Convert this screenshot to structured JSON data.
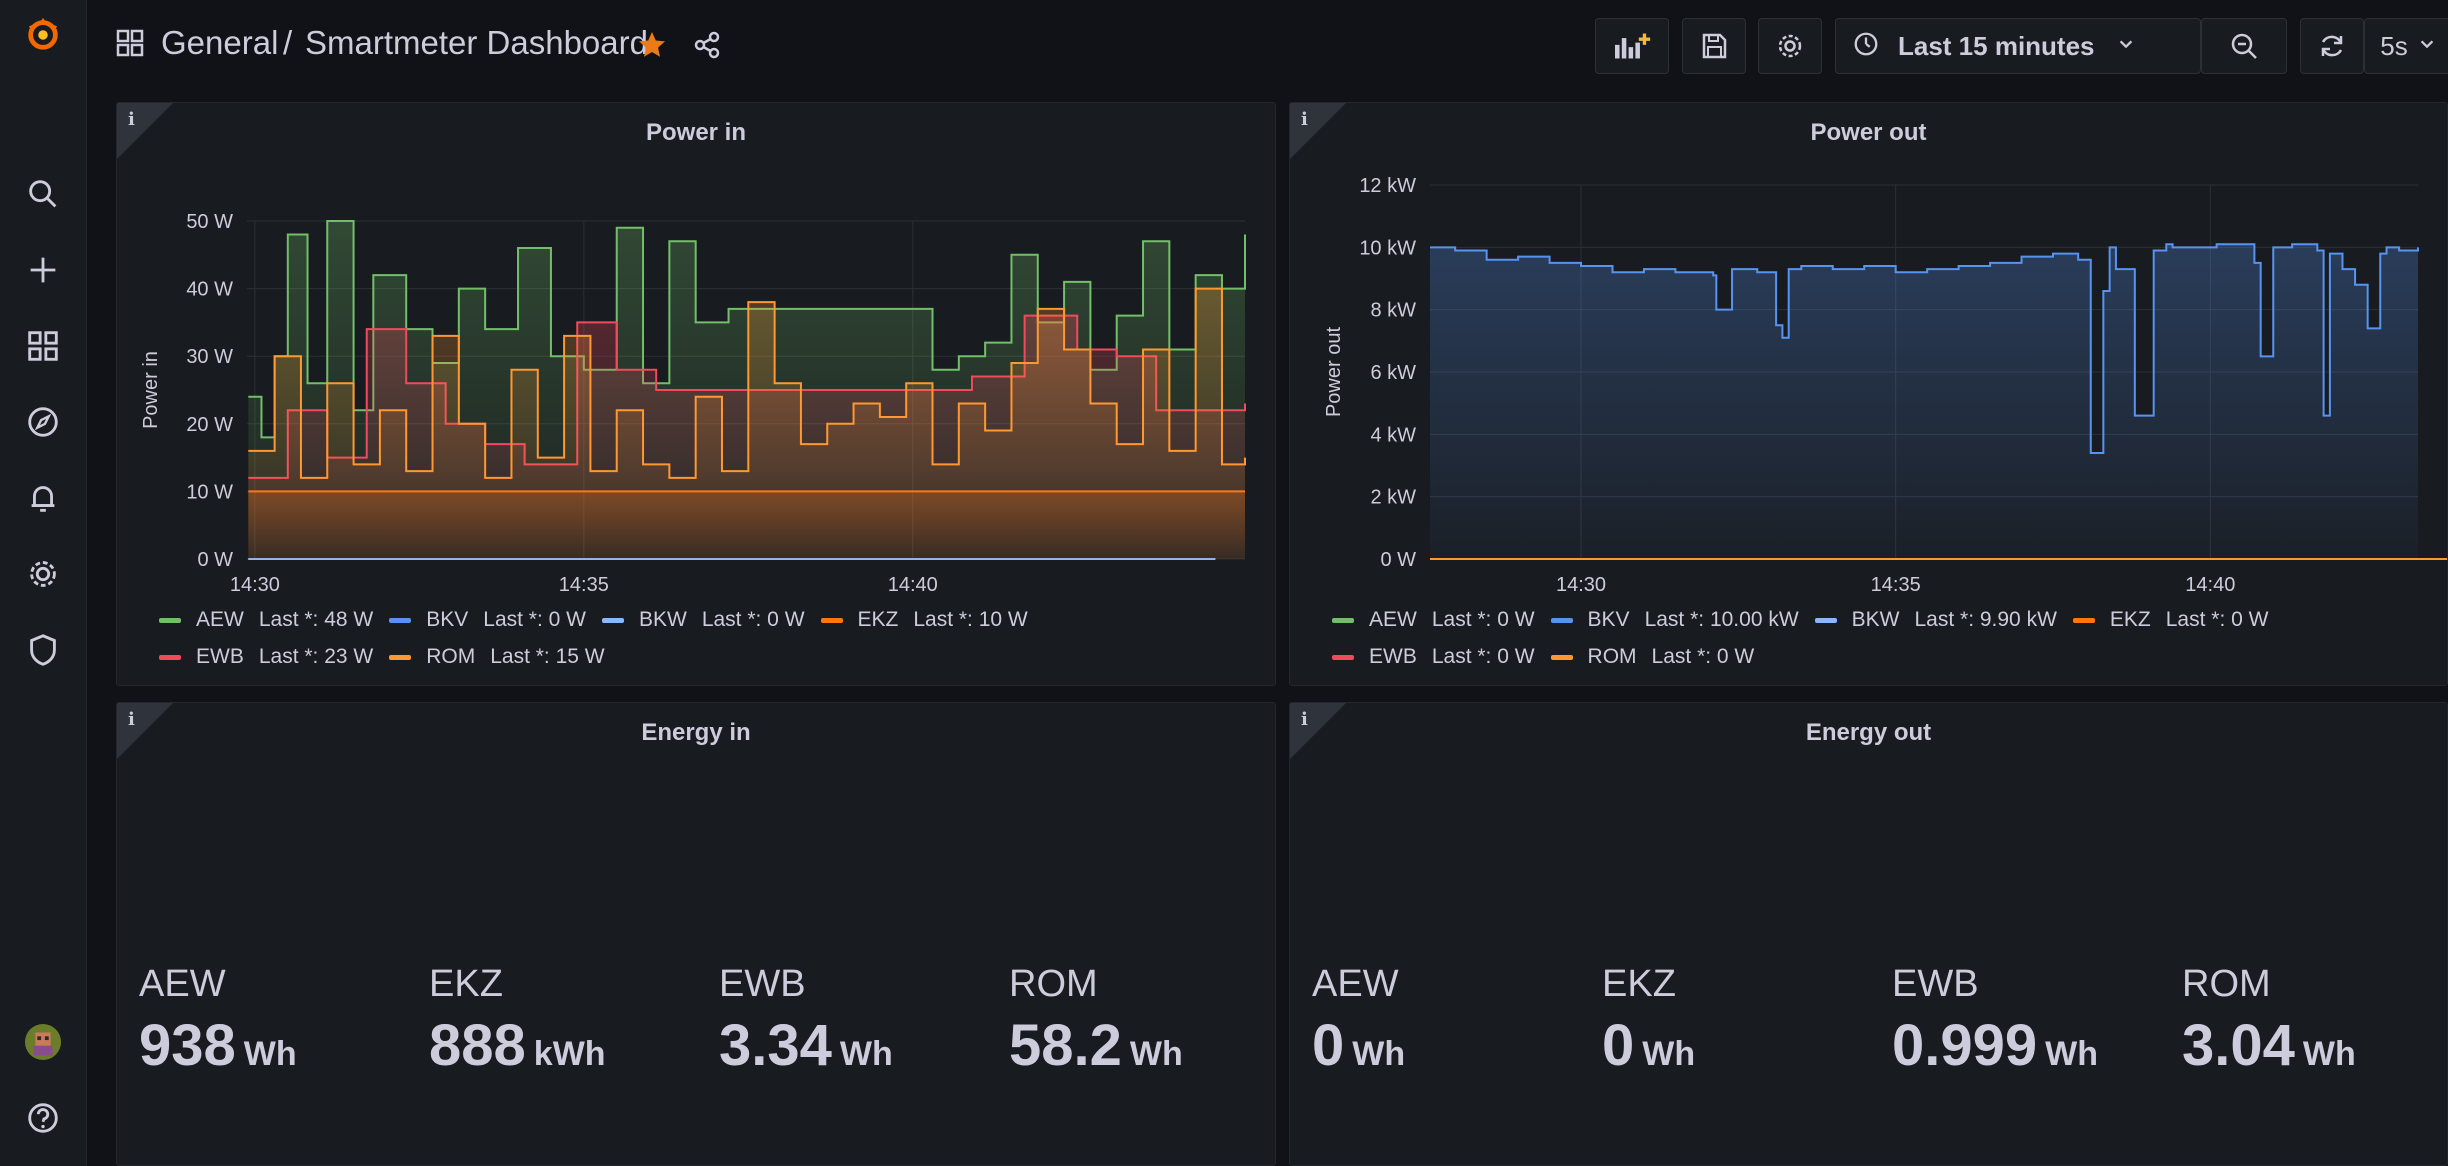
{
  "breadcrumb": {
    "folder": "General",
    "separator": "/",
    "dashboard": "Smartmeter Dashboard"
  },
  "toolbar": {
    "time_range": "Last 15 minutes",
    "refresh_interval": "5s"
  },
  "panels": {
    "power_in": {
      "title": "Power in",
      "info": "i"
    },
    "power_out": {
      "title": "Power out",
      "info": "i"
    },
    "energy_in": {
      "title": "Energy in",
      "info": "i"
    },
    "energy_out": {
      "title": "Energy out",
      "info": "i"
    }
  },
  "colors": {
    "AEW": "#73bf69",
    "BKV": "#5794f2",
    "BKW": "#8ab8ff",
    "EKZ": "#ff780a",
    "EWB": "#f2495c",
    "ROM": "#ff9830"
  },
  "legend_power_in": [
    {
      "name": "AEW",
      "last": "Last *: 48 W",
      "color": "#73bf69"
    },
    {
      "name": "BKV",
      "last": "Last *: 0 W",
      "color": "#5794f2"
    },
    {
      "name": "BKW",
      "last": "Last *: 0 W",
      "color": "#8ab8ff"
    },
    {
      "name": "EKZ",
      "last": "Last *: 10 W",
      "color": "#ff780a"
    },
    {
      "name": "EWB",
      "last": "Last *: 23 W",
      "color": "#f2495c"
    },
    {
      "name": "ROM",
      "last": "Last *: 15 W",
      "color": "#ff9830"
    }
  ],
  "legend_power_out": [
    {
      "name": "AEW",
      "last": "Last *: 0 W",
      "color": "#73bf69"
    },
    {
      "name": "BKV",
      "last": "Last *: 10.00 kW",
      "color": "#5794f2"
    },
    {
      "name": "BKW",
      "last": "Last *: 9.90 kW",
      "color": "#8ab8ff"
    },
    {
      "name": "EKZ",
      "last": "Last *: 0 W",
      "color": "#ff780a"
    },
    {
      "name": "EWB",
      "last": "Last *: 0 W",
      "color": "#f2495c"
    },
    {
      "name": "ROM",
      "last": "Last *: 0 W",
      "color": "#ff9830"
    }
  ],
  "energy_in_stats": [
    {
      "name": "AEW",
      "value": "938",
      "unit": "Wh"
    },
    {
      "name": "EKZ",
      "value": "888",
      "unit": "kWh"
    },
    {
      "name": "EWB",
      "value": "3.34",
      "unit": "Wh"
    },
    {
      "name": "ROM",
      "value": "58.2",
      "unit": "Wh"
    }
  ],
  "energy_out_stats": [
    {
      "name": "AEW",
      "value": "0",
      "unit": "Wh"
    },
    {
      "name": "EKZ",
      "value": "0",
      "unit": "Wh"
    },
    {
      "name": "EWB",
      "value": "0.999",
      "unit": "Wh"
    },
    {
      "name": "ROM",
      "value": "3.04",
      "unit": "Wh"
    }
  ],
  "chart_data": [
    {
      "type": "line",
      "title": "Power in",
      "ylabel": "Power in",
      "xlabel": "",
      "x_ticks": [
        "14:30",
        "14:35",
        "14:40"
      ],
      "y_ticks": [
        "0 W",
        "10 W",
        "20 W",
        "30 W",
        "40 W",
        "50 W"
      ],
      "ylim": [
        0,
        50
      ],
      "xlim_minutes": [
        14.38,
        29.55
      ],
      "series": [
        {
          "name": "AEW",
          "color": "#73bf69",
          "fill": true,
          "x": [
            14.4,
            14.6,
            14.8,
            15.0,
            15.3,
            15.6,
            16.0,
            16.3,
            16.8,
            17.2,
            17.6,
            18.0,
            18.5,
            19.0,
            19.5,
            20.0,
            20.4,
            20.8,
            21.2,
            21.7,
            22.2,
            22.6,
            23.0,
            23.5,
            24.0,
            24.4,
            24.8,
            25.2,
            25.6,
            26.0,
            26.4,
            26.8,
            27.2,
            27.6,
            28.0,
            28.4,
            28.8,
            29.2,
            29.55
          ],
          "y": [
            24,
            18,
            30,
            48,
            26,
            50,
            22,
            42,
            34,
            29,
            40,
            34,
            46,
            30,
            28,
            49,
            26,
            47,
            35,
            37,
            37,
            37,
            37,
            37,
            37,
            37,
            28,
            30,
            32,
            45,
            35,
            41,
            28,
            36,
            47,
            31,
            42,
            40,
            48
          ]
        },
        {
          "name": "BKV",
          "color": "#5794f2",
          "fill": false,
          "x": [
            14.4,
            29.1
          ],
          "y": [
            0,
            0
          ]
        },
        {
          "name": "BKW",
          "color": "#8ab8ff",
          "fill": false,
          "x": [
            14.4,
            29.1
          ],
          "y": [
            0,
            0
          ]
        },
        {
          "name": "EKZ",
          "color": "#ff780a",
          "fill": true,
          "x": [
            14.4,
            15.0,
            16.0,
            17.0,
            18.0,
            19.0,
            20.0,
            21.0,
            22.0,
            23.0,
            24.0,
            25.0,
            26.0,
            27.0,
            28.0,
            29.0,
            29.55
          ],
          "y": [
            10,
            10,
            10,
            10,
            10,
            10,
            10,
            10,
            10,
            10,
            10,
            10,
            10,
            10,
            10,
            10,
            10
          ]
        },
        {
          "name": "EWB",
          "color": "#f2495c",
          "fill": true,
          "x": [
            14.4,
            15.0,
            15.6,
            16.2,
            16.8,
            17.4,
            18.0,
            18.6,
            19.4,
            20.0,
            20.6,
            21.4,
            22.2,
            23.0,
            23.8,
            24.6,
            25.4,
            26.2,
            27.0,
            27.6,
            28.2,
            28.8,
            29.55
          ],
          "y": [
            12,
            22,
            15,
            34,
            26,
            20,
            17,
            14,
            35,
            28,
            25,
            25,
            25,
            25,
            25,
            25,
            27,
            36,
            31,
            30,
            22,
            22,
            23
          ]
        },
        {
          "name": "ROM",
          "color": "#ff9830",
          "fill": true,
          "x": [
            14.4,
            14.8,
            15.2,
            15.6,
            16.0,
            16.4,
            16.8,
            17.2,
            17.6,
            18.0,
            18.4,
            18.8,
            19.2,
            19.6,
            20.0,
            20.4,
            20.8,
            21.2,
            21.6,
            22.0,
            22.4,
            22.8,
            23.2,
            23.6,
            24.0,
            24.4,
            24.8,
            25.2,
            25.6,
            26.0,
            26.4,
            26.8,
            27.2,
            27.6,
            28.0,
            28.4,
            28.8,
            29.2,
            29.55
          ],
          "y": [
            16,
            30,
            12,
            26,
            14,
            22,
            13,
            33,
            20,
            12,
            28,
            15,
            33,
            13,
            22,
            14,
            12,
            24,
            13,
            38,
            26,
            17,
            20,
            23,
            21,
            26,
            14,
            23,
            19,
            29,
            37,
            31,
            23,
            17,
            31,
            16,
            40,
            14,
            15
          ]
        }
      ]
    },
    {
      "type": "line",
      "title": "Power out",
      "ylabel": "Power out",
      "xlabel": "",
      "x_ticks": [
        "14:30",
        "14:35",
        "14:40"
      ],
      "y_ticks": [
        "0 W",
        "2 kW",
        "4 kW",
        "6 kW",
        "8 kW",
        "10 kW",
        "12 kW"
      ],
      "ylim": [
        0,
        12
      ],
      "xlim_minutes": [
        27.1,
        42.8
      ],
      "series": [
        {
          "name": "BKV",
          "color": "#5794f2",
          "fill": true,
          "x": [
            27.1,
            27.5,
            28.0,
            28.5,
            29.0,
            29.5,
            30.0,
            30.5,
            31.0,
            31.6,
            31.65,
            31.9,
            32.3,
            32.6,
            32.7,
            32.8,
            33.0,
            33.5,
            34.0,
            34.5,
            35.0,
            35.5,
            36.0,
            36.5,
            37.0,
            37.4,
            37.6,
            37.8,
            37.9,
            38.0,
            38.3,
            38.6,
            38.8,
            38.9,
            39.2,
            39.6,
            40.0,
            40.2,
            40.3,
            40.5,
            40.8,
            41.2,
            41.3,
            41.4,
            41.6,
            41.8,
            42.0,
            42.2,
            42.3,
            42.5,
            42.8
          ],
          "y": [
            10.0,
            9.9,
            9.6,
            9.7,
            9.5,
            9.4,
            9.2,
            9.3,
            9.2,
            9.1,
            8.0,
            9.3,
            9.2,
            7.5,
            7.1,
            9.3,
            9.4,
            9.3,
            9.4,
            9.2,
            9.3,
            9.4,
            9.5,
            9.7,
            9.8,
            9.6,
            3.4,
            8.6,
            10.0,
            9.3,
            4.6,
            9.9,
            10.1,
            10.0,
            10.0,
            10.1,
            10.1,
            9.5,
            6.5,
            10.0,
            10.1,
            9.9,
            4.6,
            9.8,
            9.3,
            8.8,
            7.4,
            9.8,
            10.0,
            9.9,
            10.0
          ]
        },
        {
          "name": "ROM",
          "color": "#ff9830",
          "fill": false,
          "x": [
            27.1,
            43.9
          ],
          "y": [
            0,
            0
          ]
        }
      ]
    }
  ]
}
